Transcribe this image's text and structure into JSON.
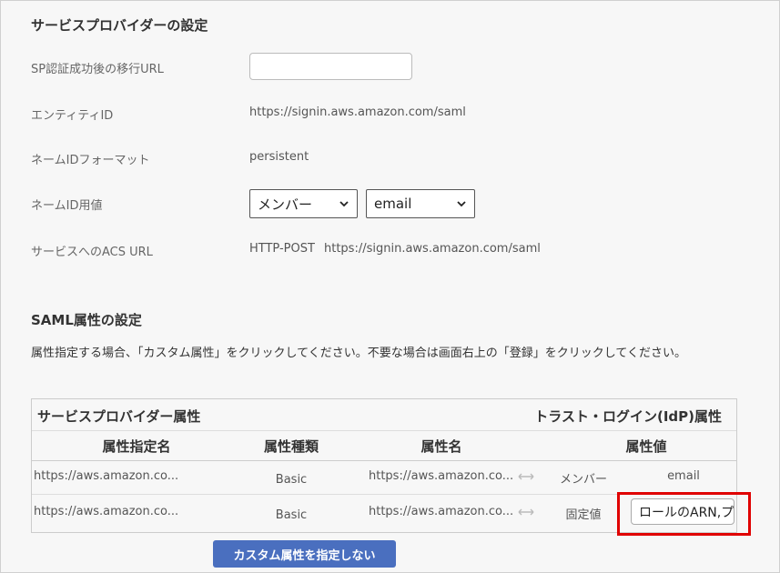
{
  "sp_settings": {
    "title": "サービスプロバイダーの設定",
    "redirect_url": {
      "label": "SP認証成功後の移行URL",
      "value": "",
      "placeholder": ""
    },
    "entity_id": {
      "label": "エンティティID",
      "value": "https://signin.aws.amazon.com/saml"
    },
    "name_id_format": {
      "label": "ネームIDフォーマット",
      "value": "persistent"
    },
    "name_id_value": {
      "label": "ネームID用値",
      "select1": "メンバー",
      "select2": "email"
    },
    "acs_url": {
      "label": "サービスへのACS URL",
      "binding": "HTTP-POST",
      "url": "https://signin.aws.amazon.com/saml"
    }
  },
  "saml_attributes": {
    "title": "SAML属性の設定",
    "description": "属性指定する場合、「カスタム属性」をクリックしてください。不要な場合は画面右上の「登録」をクリックしてください。",
    "table": {
      "group_sp": "サービスプロバイダー属性",
      "group_idp": "トラスト・ログイン(IdP)属性",
      "columns": [
        "属性指定名",
        "属性種類",
        "属性名",
        "属性値"
      ],
      "rows": [
        {
          "spec_name": "https://aws.amazon.co...",
          "type": "Basic",
          "attr_name": "https://aws.amazon.co...",
          "source": "メンバー",
          "value": "email"
        },
        {
          "spec_name": "https://aws.amazon.co...",
          "type": "Basic",
          "attr_name": "https://aws.amazon.co...",
          "source": "固定値",
          "value": "ロールのARN,プロバイダーのARN"
        }
      ]
    },
    "custom_button_label": "カスタム属性を指定しない"
  },
  "colors": {
    "accent_button": "#4a6fbf",
    "highlight": "#e00000"
  }
}
